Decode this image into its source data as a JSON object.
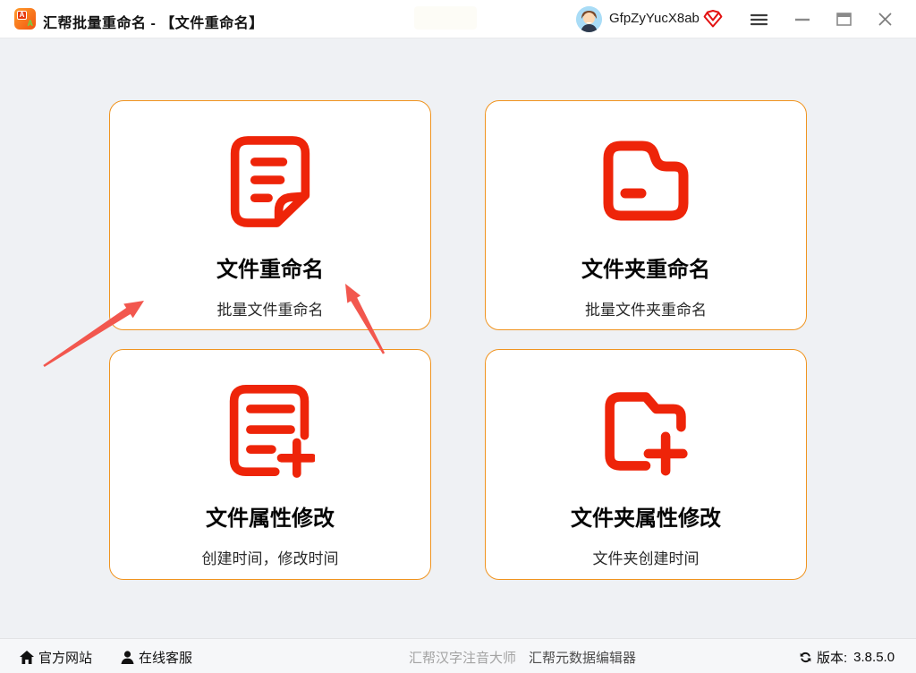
{
  "titlebar": {
    "app_title": "汇帮批量重命名 - 【文件重命名】",
    "username": "GfpZyYucX8ab",
    "app_logo_letter_top": "A",
    "app_logo_letter_bottom": "A",
    "icons": {
      "app": "app-logo",
      "vip": "vip-gem-icon",
      "menu": "hamburger-menu-icon",
      "minimize": "minimize-icon",
      "maximize": "maximize-icon",
      "close": "close-icon"
    }
  },
  "cards": [
    {
      "title": "文件重命名",
      "subtitle": "批量文件重命名",
      "icon": "file-lines-icon"
    },
    {
      "title": "文件夹重命名",
      "subtitle": "批量文件夹重命名",
      "icon": "folder-icon"
    },
    {
      "title": "文件属性修改",
      "subtitle": "创建时间，修改时间",
      "icon": "file-plus-icon"
    },
    {
      "title": "文件夹属性修改",
      "subtitle": "文件夹创建时间",
      "icon": "folder-plus-icon"
    }
  ],
  "footer": {
    "official_site": "官方网站",
    "online_support": "在线客服",
    "pinyin_app": "汇帮汉字注音大师",
    "metadata_app": "汇帮元数据编辑器",
    "version_label": "版本:",
    "version_value": "3.8.5.0"
  },
  "colors": {
    "icon_red": "#ee2409",
    "card_border": "#f0941f",
    "arrow_red": "#f2574e",
    "titlebar_bg": "#ffffff",
    "main_bg": "#eff1f4"
  }
}
